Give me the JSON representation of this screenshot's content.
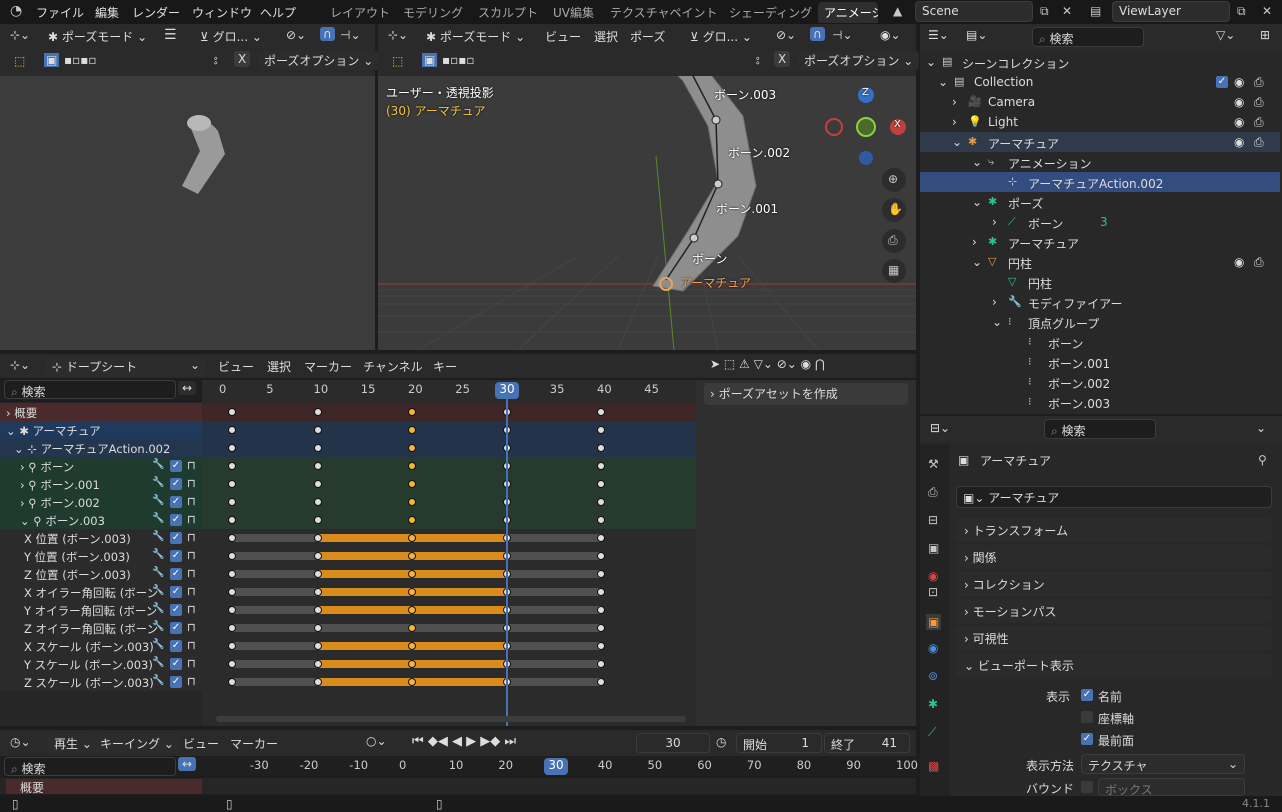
{
  "topmenu": {
    "file": "ファイル",
    "edit": "編集",
    "render": "レンダー",
    "window": "ウィンドウ",
    "help": "ヘルプ"
  },
  "workspaces": [
    "レイアウト",
    "モデリング",
    "スカルプト",
    "UV編集",
    "テクスチャペイント",
    "シェーディング",
    "アニメーシ"
  ],
  "scene": "Scene",
  "viewlayer": "ViewLayer",
  "leftvp": {
    "mode": "ポーズモード",
    "orient": "グロ...",
    "options": "ポーズオプション",
    "x": "X"
  },
  "mainvp": {
    "mode": "ポーズモード",
    "menu_view": "ビュー",
    "menu_select": "選択",
    "menu_pose": "ポーズ",
    "orient": "グロ...",
    "options": "ポーズオプション",
    "x": "X",
    "view_label": "ユーザー・透視投影",
    "obj_label": "(30) アーマチュア",
    "bones": [
      "ボーン.003",
      "ボーン.002",
      "ボーン.001",
      "ボーン",
      "アーマチュア"
    ],
    "axis_z": "Z",
    "axis_x": "X"
  },
  "dopesheet": {
    "mode": "ドープシート",
    "menus": [
      "ビュー",
      "選択",
      "マーカー",
      "チャンネル",
      "キー"
    ],
    "search_placeholder": "検索",
    "create_pose": "ポーズアセットを作成",
    "current_frame": "30",
    "ticks": [
      "0",
      "5",
      "10",
      "15",
      "20",
      "25",
      "30",
      "35",
      "40",
      "45"
    ],
    "channels": [
      "概要",
      "アーマチュア",
      "アーマチュアAction.002",
      "ボーン",
      "ボーン.001",
      "ボーン.002",
      "ボーン.003",
      "X 位置 (ボーン.003)",
      "Y 位置 (ボーン.003)",
      "Z 位置 (ボーン.003)",
      "X オイラー角回転 (ボーン",
      "Y オイラー角回転 (ボーン",
      "Z オイラー角回転 (ボーン",
      "X スケール (ボーン.003)",
      "Y スケール (ボーン.003)",
      "Z スケール (ボーン.003)"
    ]
  },
  "timeline": {
    "playback": "再生",
    "keying": "キーイング",
    "view": "ビュー",
    "marker": "マーカー",
    "frame": "30",
    "start_label": "開始",
    "start": "1",
    "end_label": "終了",
    "end": "41",
    "search_placeholder": "検索",
    "summary": "概要",
    "ticks": [
      "-30",
      "-20",
      "-10",
      "0",
      "10",
      "20",
      "30",
      "40",
      "50",
      "60",
      "70",
      "80",
      "90",
      "100"
    ]
  },
  "outliner": {
    "search_placeholder": "検索",
    "items": [
      "シーンコレクション",
      "Collection",
      "Camera",
      "Light",
      "アーマチュア",
      "アニメーション",
      "アーマチュアAction.002",
      "ポーズ",
      "ボーン",
      "アーマチュア",
      "円柱",
      "円柱",
      "モディファイアー",
      "頂点グループ",
      "ボーン",
      "ボーン.001",
      "ボーン.002",
      "ボーン.003"
    ],
    "bone_count": "3"
  },
  "props": {
    "search_placeholder": "検索",
    "title": "アーマチュア",
    "datablock": "アーマチュア",
    "panels": [
      "トランスフォーム",
      "関係",
      "コレクション",
      "モーションパス",
      "可視性",
      "ビューポート表示"
    ],
    "show_label": "表示",
    "show_names": "名前",
    "show_axes": "座標軸",
    "show_front": "最前面",
    "display_as_label": "表示方法",
    "display_as": "テクスチャ",
    "bounds_label": "バウンド",
    "bounds": "ボックス"
  },
  "version": "4.1.1"
}
